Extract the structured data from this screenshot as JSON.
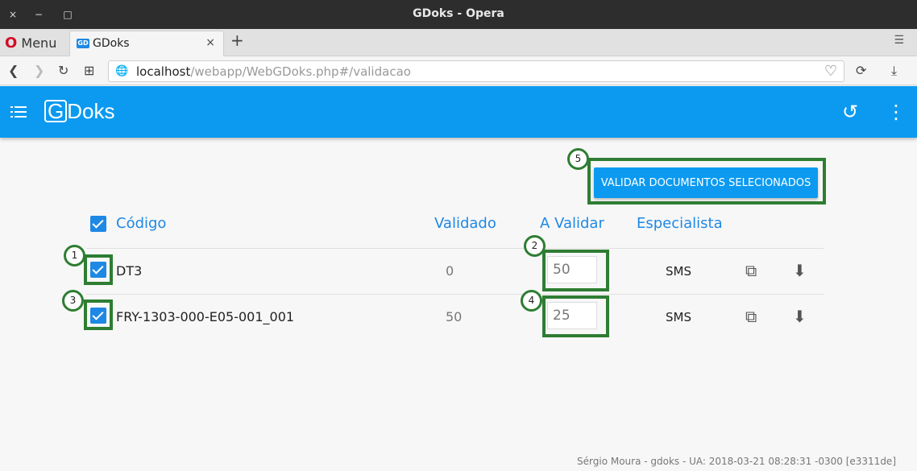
{
  "window": {
    "title": "GDoks - Opera",
    "close": "×",
    "minimize": "−",
    "maximize": "□"
  },
  "tabs": {
    "menu_label": "Menu",
    "tab_label": "GDoks",
    "tab_close": "×",
    "new_tab": "+"
  },
  "address": {
    "host": "localhost",
    "path": "/webapp/WebGDoks.php#/validacao"
  },
  "app": {
    "logo_g": "G",
    "logo_rest": "Doks",
    "validate_button": "VALIDAR DOCUMENTOS SELECIONADOS"
  },
  "table": {
    "headers": {
      "code": "Código",
      "validated": "Validado",
      "to_validate": "A Validar",
      "specialist": "Especialista"
    },
    "rows": [
      {
        "code": "DT3",
        "validated": "0",
        "to_validate": "50",
        "specialist": "SMS"
      },
      {
        "code": "FRY-1303-000-E05-001_001",
        "validated": "50",
        "to_validate": "25",
        "specialist": "SMS"
      }
    ]
  },
  "annotations": [
    "1",
    "2",
    "3",
    "4",
    "5"
  ],
  "footer": "Sérgio Moura - gdoks - UA: 2018-03-21 08:28:31 -0300 [e3311de]"
}
